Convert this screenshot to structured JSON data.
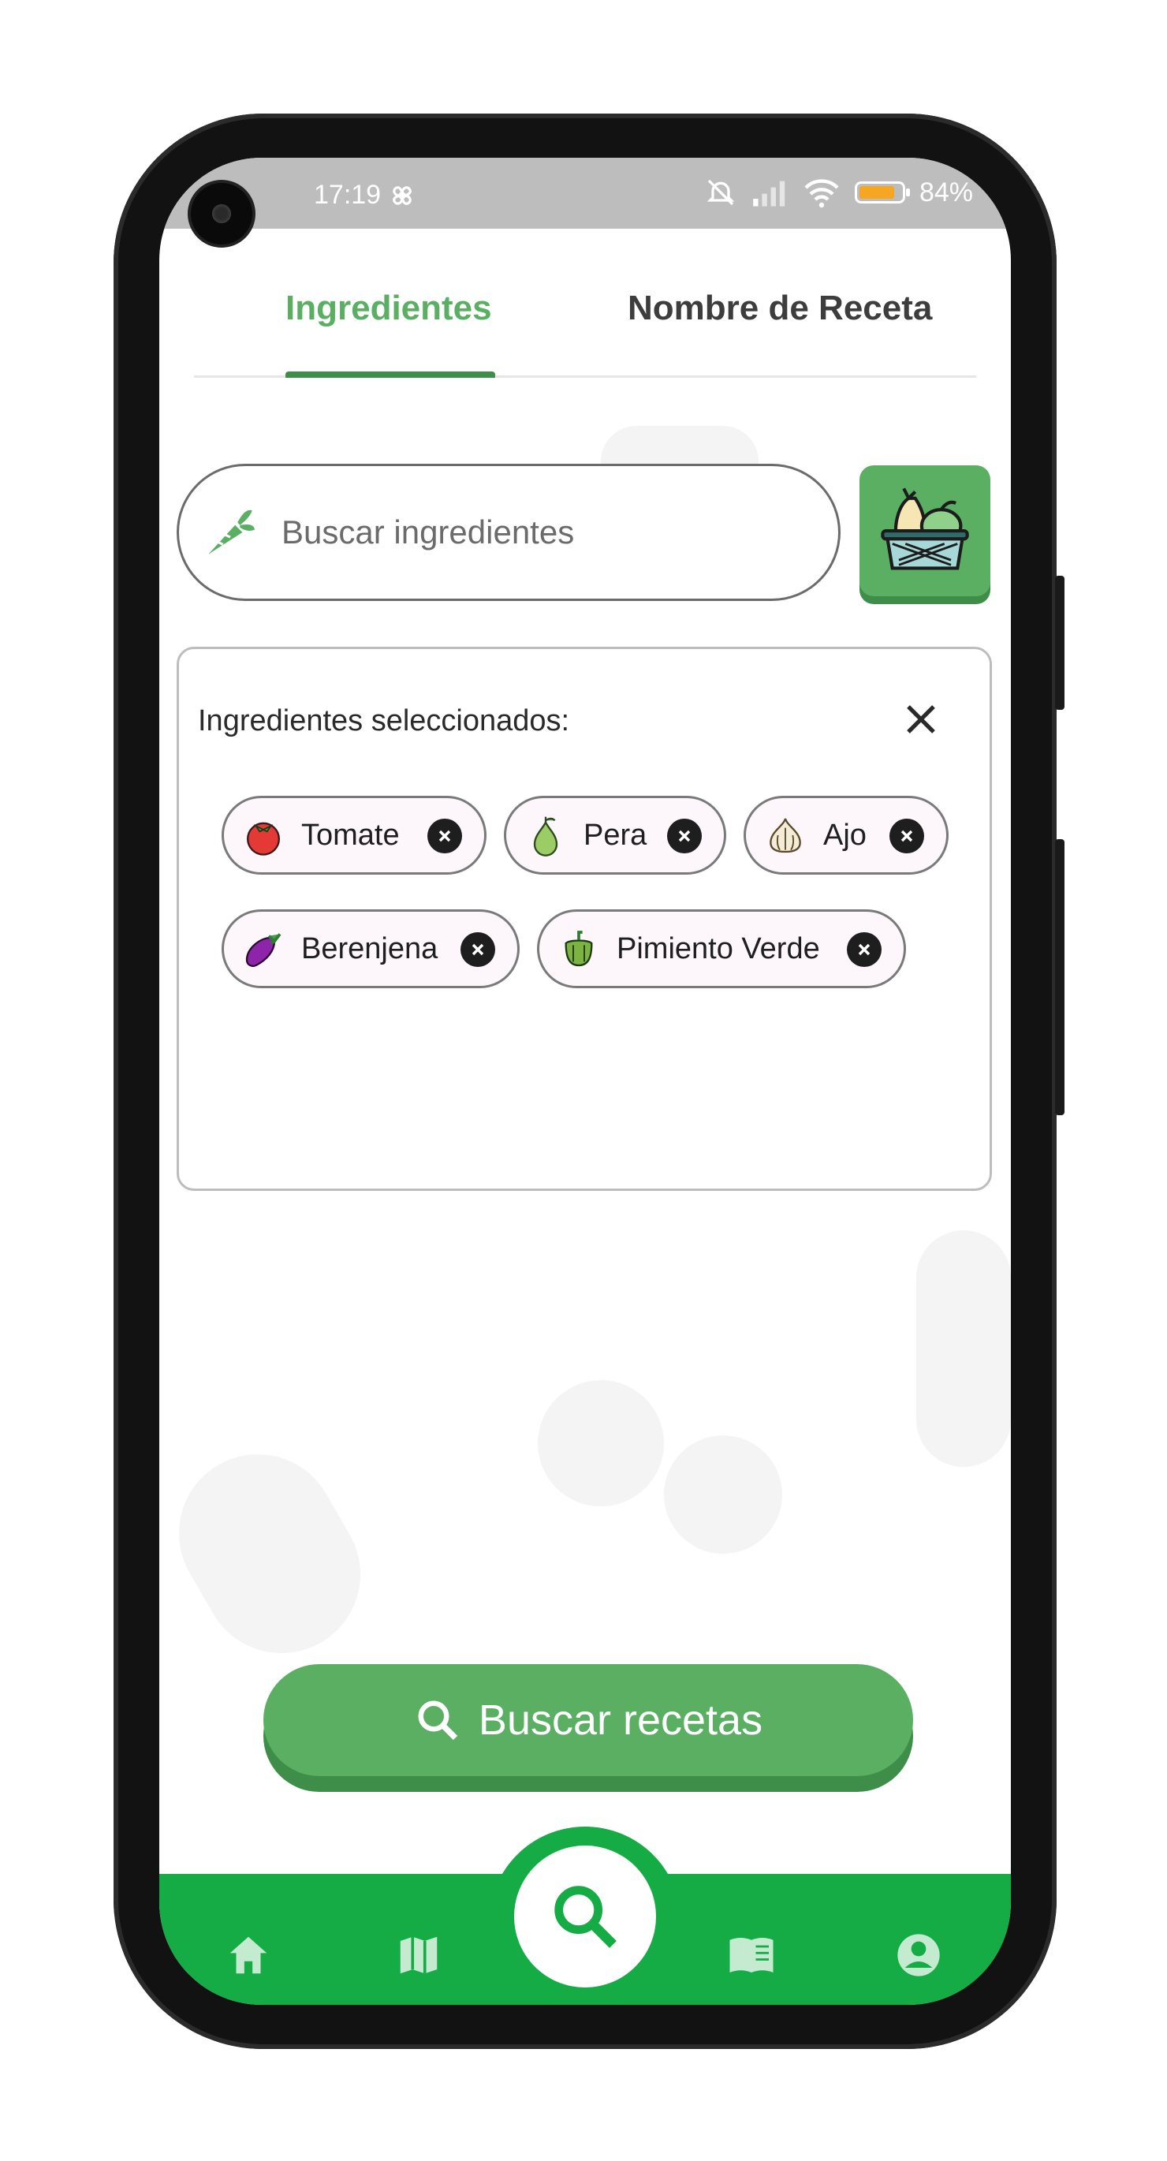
{
  "status_bar": {
    "time": "17:19",
    "battery": "84%"
  },
  "tabs": [
    {
      "label": "Ingredientes",
      "active": true
    },
    {
      "label": "Nombre de Receta",
      "active": false
    }
  ],
  "search": {
    "placeholder": "Buscar ingredientes",
    "value": ""
  },
  "selected": {
    "title": "Ingredientes seleccionados:",
    "chips": [
      {
        "label": "Tomate",
        "icon": "tomato-icon"
      },
      {
        "label": "Pera",
        "icon": "pear-icon"
      },
      {
        "label": "Ajo",
        "icon": "garlic-icon"
      },
      {
        "label": "Berenjena",
        "icon": "eggplant-icon"
      },
      {
        "label": "Pimiento Verde",
        "icon": "green-pepper-icon"
      }
    ]
  },
  "search_button": {
    "label": "Buscar recetas"
  },
  "nav": {
    "items": [
      {
        "icon": "home-icon"
      },
      {
        "icon": "map-icon"
      },
      {
        "icon": "search-icon"
      },
      {
        "icon": "book-icon"
      },
      {
        "icon": "account-icon"
      }
    ]
  },
  "colors": {
    "primary": "#5aaf63",
    "primary_dark": "#3e8e4a",
    "nav_green": "#15ab45"
  }
}
